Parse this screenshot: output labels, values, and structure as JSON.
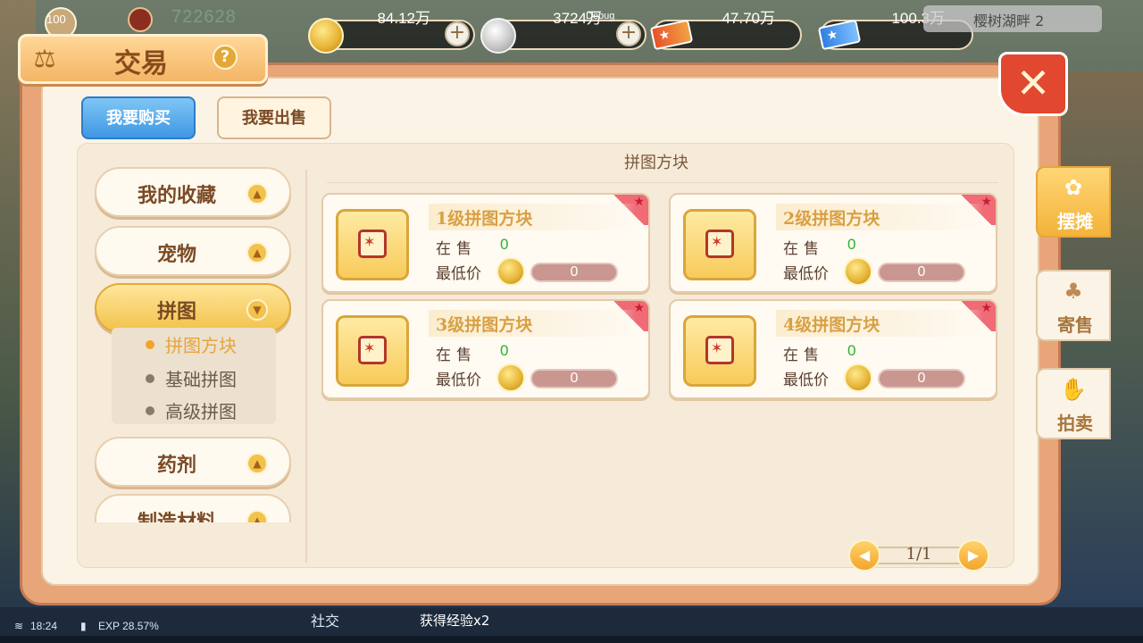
{
  "hud": {
    "level": "100",
    "power": "722628",
    "debug": "Debug",
    "map_name": "樱树湖畔 2",
    "resources": [
      {
        "icon": "gold-coin-icon",
        "value": "84.12万"
      },
      {
        "icon": "silver-coin-icon",
        "value": "3724万"
      },
      {
        "icon": "red-ticket-icon",
        "value": "47.70万"
      },
      {
        "icon": "blue-ticket-icon",
        "value": "100.3万"
      }
    ]
  },
  "window": {
    "title": "交易",
    "close": "✕"
  },
  "tabs": {
    "buy": "我要购买",
    "sell": "我要出售"
  },
  "categories": [
    {
      "label": "我的收藏"
    },
    {
      "label": "宠物"
    },
    {
      "label": "拼图"
    },
    {
      "label": "药剂"
    },
    {
      "label": "制造材料"
    }
  ],
  "subcategories": [
    {
      "label": "拼图方块"
    },
    {
      "label": "基础拼图"
    },
    {
      "label": "高级拼图"
    }
  ],
  "section_title": "拼图方块",
  "item_labels": {
    "on_sale": "在售",
    "min_price": "最低价"
  },
  "items": [
    {
      "name": "1级拼图方块",
      "on_sale": "0",
      "min_price": "0"
    },
    {
      "name": "2级拼图方块",
      "on_sale": "0",
      "min_price": "0"
    },
    {
      "name": "3级拼图方块",
      "on_sale": "0",
      "min_price": "0"
    },
    {
      "name": "4级拼图方块",
      "on_sale": "0",
      "min_price": "0"
    }
  ],
  "pager": {
    "text": "1/1"
  },
  "side_tabs": [
    {
      "label": "摆摊",
      "icon": "stall-icon"
    },
    {
      "label": "寄售",
      "icon": "bag-icon"
    },
    {
      "label": "拍卖",
      "icon": "auction-icon"
    }
  ],
  "status": {
    "time": "18:24",
    "exp": "EXP 28.57%",
    "social": "社交",
    "chat": "获得经验x2"
  },
  "colors": {
    "accent": "#f2c24b",
    "tab_active": "#3f97e4",
    "close": "#e2472f",
    "on_sale_value": "#2fb02f"
  }
}
